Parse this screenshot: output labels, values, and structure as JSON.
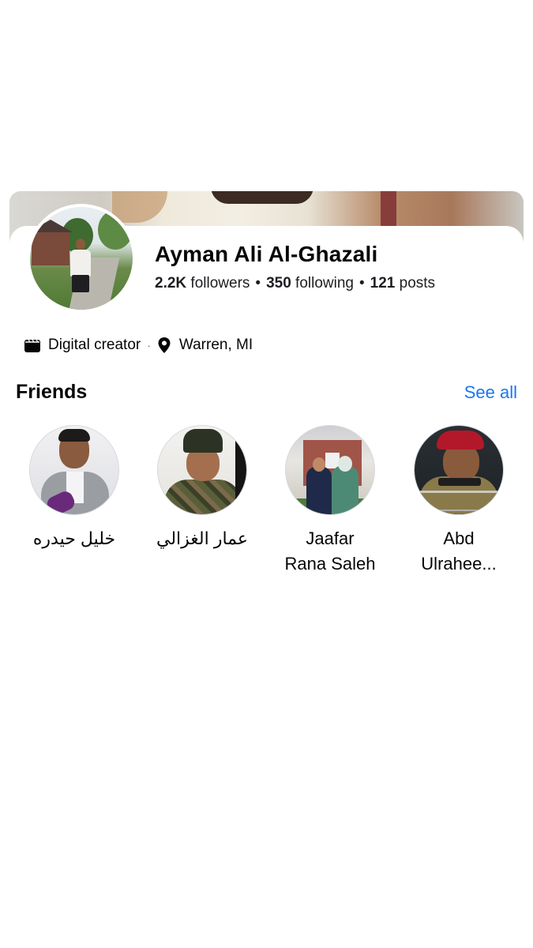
{
  "profile": {
    "name": "Ayman Ali Al-Ghazali",
    "followers_count": "2.2K",
    "followers_label": "followers",
    "following_count": "350",
    "following_label": "following",
    "posts_count": "121",
    "posts_label": "posts",
    "separator": "•"
  },
  "meta": {
    "category_icon": "clapperboard-icon",
    "category": "Digital creator",
    "location_icon": "location-pin-icon",
    "location": "Warren, MI",
    "separator": "·"
  },
  "friends": {
    "title": "Friends",
    "see_all_label": "See all",
    "items": [
      {
        "name_line1": "خليل حيدره",
        "name_line2": ""
      },
      {
        "name_line1": "عمار الغزالي",
        "name_line2": ""
      },
      {
        "name_line1": "Jaafar",
        "name_line2": "Rana Saleh"
      },
      {
        "name_line1": "Abd",
        "name_line2": "Ulrahee..."
      }
    ]
  },
  "colors": {
    "accent": "#1877f2",
    "text": "#050505",
    "secondary": "#65676b"
  }
}
